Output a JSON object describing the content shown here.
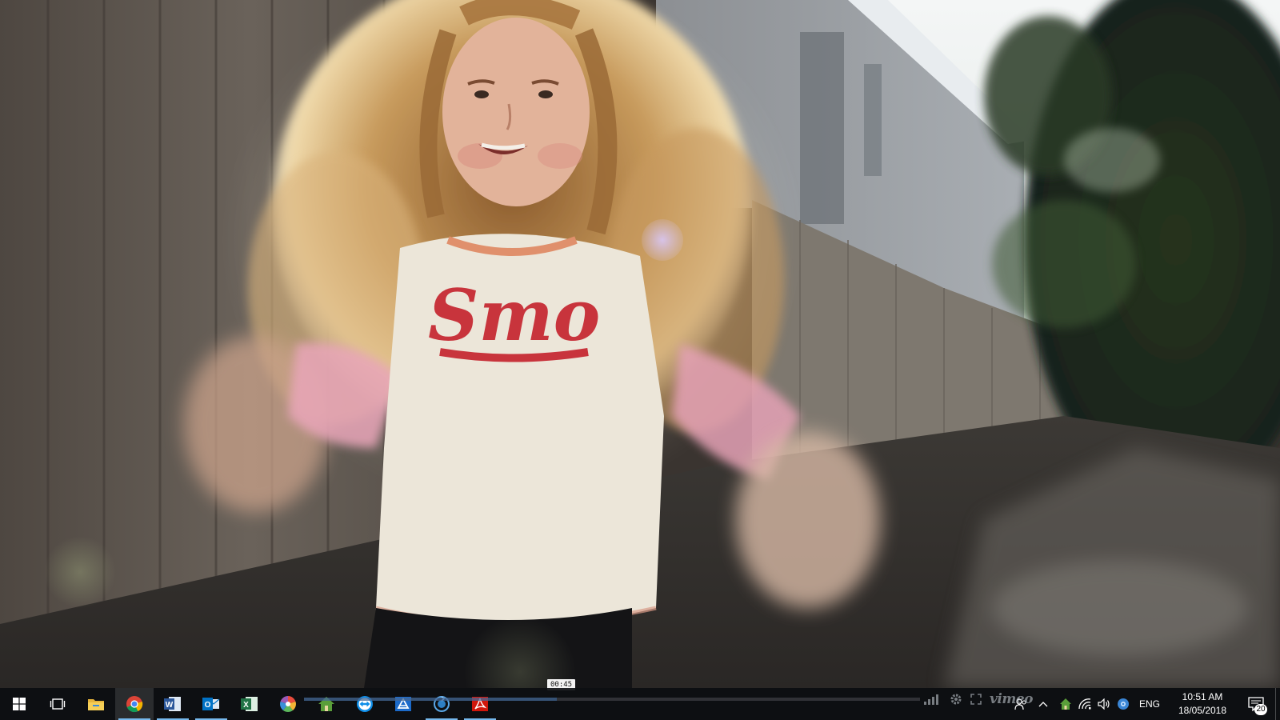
{
  "video": {
    "shirt_text": "Smo",
    "hover_time": "00:45",
    "progress_fraction": 0.41,
    "brand_label": "vimeo"
  },
  "taskbar": {
    "start_icon": "windows-start-icon",
    "apps": [
      {
        "name": "task-view",
        "icon": "task-view-icon"
      },
      {
        "name": "file-explorer",
        "icon": "folder-icon"
      },
      {
        "name": "chrome",
        "icon": "chrome-icon"
      },
      {
        "name": "word",
        "icon": "word-icon",
        "letter": "W"
      },
      {
        "name": "outlook",
        "icon": "outlook-icon",
        "letter": "O"
      },
      {
        "name": "excel",
        "icon": "excel-icon",
        "letter": "X"
      },
      {
        "name": "color-app",
        "icon": "color-wheel-icon"
      },
      {
        "name": "home-app",
        "icon": "house-icon"
      },
      {
        "name": "teamviewer",
        "icon": "teamviewer-icon"
      },
      {
        "name": "azure-app",
        "icon": "azure-icon"
      },
      {
        "name": "sync-app",
        "icon": "sync-icon"
      },
      {
        "name": "acrobat",
        "icon": "acrobat-icon"
      }
    ]
  },
  "tray": {
    "icons": [
      "people-icon",
      "chevron-up-icon",
      "house-icon",
      "wifi-icon",
      "volume-icon",
      "network-globe-icon"
    ],
    "language": "ENG",
    "time": "10:51 AM",
    "date": "18/05/2018",
    "notification_count": "20"
  },
  "colors": {
    "taskbar_bg": "#0e1014",
    "running_indicator": "#76b9ed",
    "shirt_print": "#c8343c"
  }
}
